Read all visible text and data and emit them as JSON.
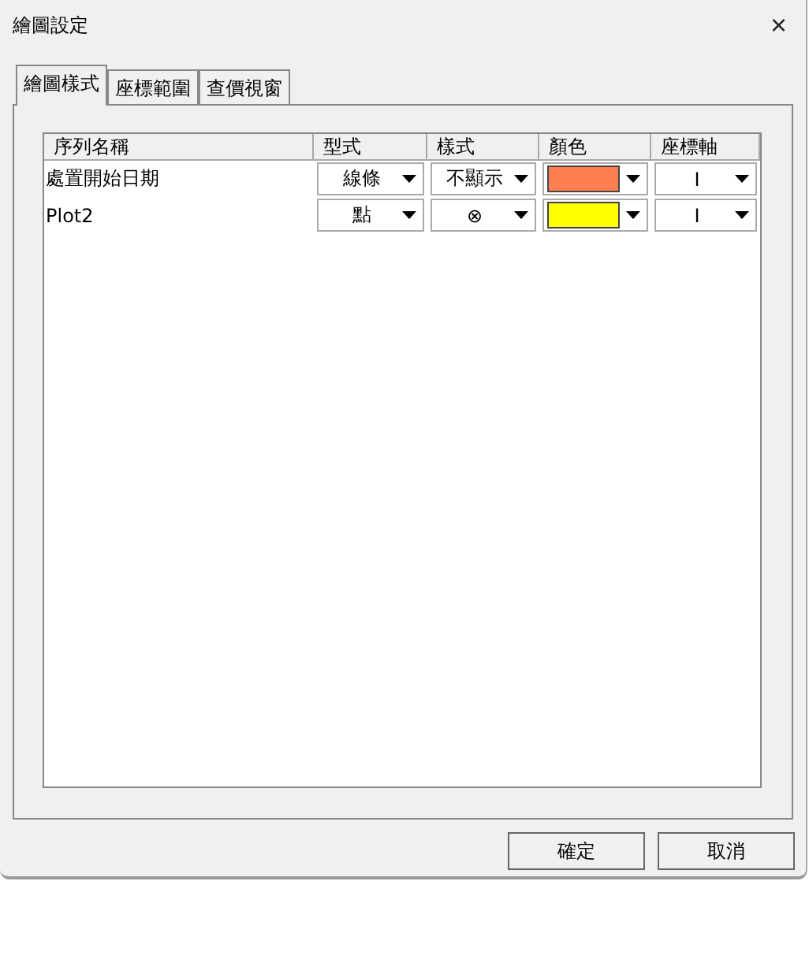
{
  "window": {
    "title": "繪圖設定",
    "close": "×"
  },
  "tabs": [
    {
      "label": "繪圖樣式",
      "selected": true
    },
    {
      "label": "座標範圍",
      "selected": false
    },
    {
      "label": "查價視窗",
      "selected": false
    }
  ],
  "table": {
    "columns": [
      "序列名稱",
      "型式",
      "樣式",
      "顏色",
      "座標軸"
    ],
    "rows": [
      {
        "name": "處置開始日期",
        "type": "線條",
        "style": "不顯示",
        "color": "#ff7f50",
        "axis": "I"
      },
      {
        "name": "Plot2",
        "type": "點",
        "style": "⊗",
        "color": "#ffff00",
        "axis": "I"
      }
    ]
  },
  "buttons": [
    "確定",
    "取消"
  ]
}
